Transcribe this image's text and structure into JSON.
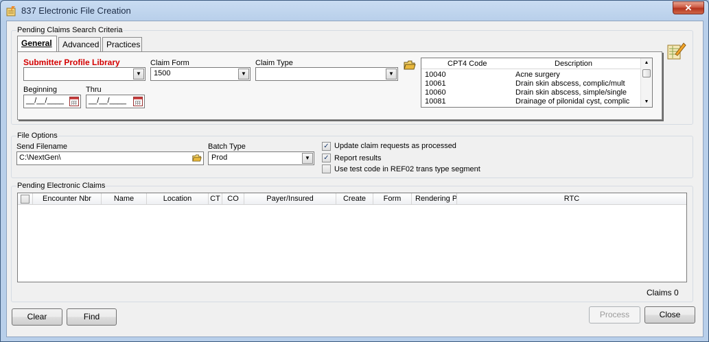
{
  "window": {
    "title": "837 Electronic File Creation",
    "close_label": "✕"
  },
  "search_criteria": {
    "group_label": "Pending Claims Search Criteria",
    "tabs": [
      {
        "label": "General",
        "active": true
      },
      {
        "label": "Advanced",
        "active": false
      },
      {
        "label": "Practices",
        "active": false
      }
    ],
    "submitter_profile_label": "Submitter Profile Library",
    "submitter_profile_value": "",
    "claim_form_label": "Claim Form",
    "claim_form_value": "1500",
    "claim_type_label": "Claim Type",
    "claim_type_value": "",
    "beginning_label": "Beginning",
    "beginning_value": "__/__/____",
    "thru_label": "Thru",
    "thru_value": "__/__/____",
    "cpt_table": {
      "headers": [
        "CPT4 Code",
        "Description"
      ],
      "rows": [
        {
          "code": "10040",
          "description": "Acne surgery"
        },
        {
          "code": "10061",
          "description": "Drain skin abscess, complic/mult"
        },
        {
          "code": "10060",
          "description": "Drain skin abscess, simple/single"
        },
        {
          "code": "10081",
          "description": "Drainage of pilonidal cyst, complic"
        }
      ]
    }
  },
  "file_options": {
    "group_label": "File Options",
    "send_filename_label": "Send Filename",
    "send_filename_value": "C:\\NextGen\\",
    "batch_type_label": "Batch Type",
    "batch_type_value": "Prod",
    "checkboxes": [
      {
        "label": "Update claim requests as processed",
        "checked": true
      },
      {
        "label": "Report results",
        "checked": true
      },
      {
        "label": "Use test code in REF02 trans type segment",
        "checked": false
      }
    ]
  },
  "pending_claims": {
    "group_label": "Pending Electronic Claims",
    "columns": [
      "Encounter Nbr",
      "Name",
      "Location",
      "CT",
      "CO",
      "Payer/Insured",
      "Create",
      "Form",
      "Rendering P",
      "RTC"
    ],
    "claims_count_label": "Claims 0"
  },
  "buttons": {
    "clear": "Clear",
    "find": "Find",
    "process": "Process",
    "close": "Close"
  },
  "colors": {
    "required_label": "#d40000",
    "title_bar": "#b8cfea"
  }
}
